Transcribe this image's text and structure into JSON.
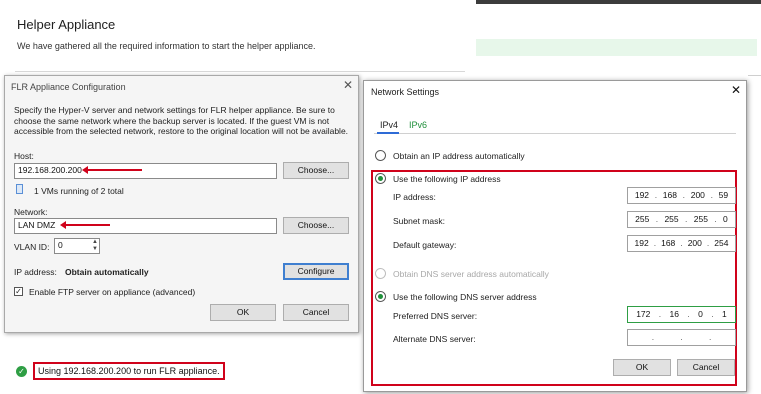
{
  "wizard": {
    "title": "Helper Appliance",
    "subtitle": "We have gathered all the required information to start the helper appliance.",
    "status_text": "Using 192.168.200.200 to run FLR appliance."
  },
  "flr": {
    "title": "FLR Appliance Configuration",
    "description": "Specify the Hyper-V server and network settings for FLR helper appliance. Be sure to choose the same network where the backup server is located. If the guest VM is not accessible from the selected network, restore to the original location will not be available.",
    "host_label": "Host:",
    "host_value": "192.168.200.200",
    "choose_label": "Choose...",
    "vms_text": "1 VMs running of 2 total",
    "network_label": "Network:",
    "network_value": "LAN DMZ",
    "vlan_label": "VLAN ID:",
    "vlan_value": "0",
    "ip_label": "IP address:",
    "ip_value": "Obtain automatically",
    "configure_label": "Configure",
    "ftp_label": "Enable FTP server on appliance (advanced)",
    "ftp_checked": true,
    "ok_label": "OK",
    "cancel_label": "Cancel"
  },
  "net": {
    "title": "Network Settings",
    "tabs": [
      {
        "label": "IPv4",
        "active": true
      },
      {
        "label": "IPv6",
        "active": false
      }
    ],
    "obtain_ip_label": "Obtain an IP address automatically",
    "use_ip_label": "Use the following IP address",
    "ip_label": "IP address:",
    "ip": [
      "192",
      "168",
      "200",
      "59"
    ],
    "mask_label": "Subnet mask:",
    "mask": [
      "255",
      "255",
      "255",
      "0"
    ],
    "gateway_label": "Default gateway:",
    "gateway": [
      "192",
      "168",
      "200",
      "254"
    ],
    "obtain_dns_label": "Obtain DNS server address automatically",
    "use_dns_label": "Use the following DNS server address",
    "pref_dns_label": "Preferred DNS server:",
    "pref_dns": [
      "172",
      "16",
      "0",
      "1"
    ],
    "alt_dns_label": "Alternate DNS server:",
    "alt_dns": [
      "",
      "",
      "",
      ""
    ],
    "ok_label": "OK",
    "cancel_label": "Cancel"
  },
  "colors": {
    "highlight_red": "#d0021b",
    "accent_green": "#2e9e44",
    "tab_blue": "#2e6bd6"
  }
}
